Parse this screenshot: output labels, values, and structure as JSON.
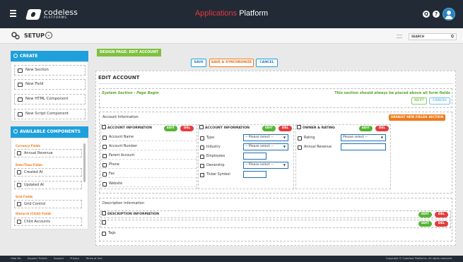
{
  "header": {
    "logo_text": "codeless",
    "logo_sub": "PLATFORMS",
    "title_accent": "Applications",
    "title_rest": " Platform",
    "icons": [
      "search-icon",
      "help-icon",
      "user-avatar"
    ],
    "search_icon_glyph": "Q",
    "help_icon_glyph": "?"
  },
  "subbar": {
    "setup_label": "SETUP",
    "chevron_glyph": "⌄",
    "search_placeholder": "SEARCH",
    "search_glyph": "Q"
  },
  "sidebar": {
    "create": {
      "title": "CREATE",
      "items": [
        {
          "label": "New Section",
          "icon": "section-icon"
        },
        {
          "label": "New Field",
          "icon": "field-icon"
        },
        {
          "label": "New HTML Component",
          "icon": "html-icon"
        },
        {
          "label": "New Script Component",
          "icon": "script-icon"
        }
      ]
    },
    "available": {
      "title": "AVAILABLE COMPONENTS",
      "groups": [
        {
          "category": "Currency Fields",
          "items": [
            "Annual Revenue"
          ]
        },
        {
          "category": "Date/Time Fields",
          "items": [
            "Created At",
            "Updated At"
          ]
        },
        {
          "category": "Grid Fields",
          "items": [
            "Grid Control"
          ]
        },
        {
          "category": "Hierarch (Child) Fields",
          "items": [
            "Child Accounts"
          ]
        }
      ]
    }
  },
  "toolbar": {
    "design_page": "DESIGN PAGE: EDIT ACCOUNT",
    "save": "SAVE",
    "save_sync": "SAVE & SYNCHRONIZE",
    "cancel": "CANCEL"
  },
  "form": {
    "title": "EDIT ACCOUNT",
    "system_section_left": "System Section - Page Begin",
    "system_section_right": "This section should always be placed above all form fields",
    "next": "NEXT",
    "cancel": "CANCEL",
    "account_info": {
      "label": "Account Information",
      "default_badge": "DEFAULT NEW FIELDS SECTION",
      "columns": [
        {
          "title": "ACCOUNT INFORMATION",
          "fields": [
            "Account Name",
            "Account Number",
            "Parent Account",
            "Phone",
            "Fax",
            "Website"
          ]
        },
        {
          "title": "ACCOUNT INFORMATION",
          "fields": [
            "Type",
            "Industry",
            "Employees",
            "Ownership",
            "Ticker Symbol"
          ],
          "select_placeholder": "-- Please select --"
        },
        {
          "title": "OWNER & RATING",
          "fields": [
            "Rating",
            "Annual Revenue"
          ],
          "select_placeholder": "Please select --"
        }
      ],
      "edit": "EDIT",
      "del": "DEL"
    },
    "description_info": {
      "label": "Description Information",
      "rows": [
        "DESCRIPTION INFORMATION",
        "",
        "Tags"
      ]
    }
  },
  "footer": {
    "links": [
      "Help Me",
      "Support Tickets",
      "Support",
      "Privacy",
      "Terms of Use"
    ],
    "copyright": "Copyright © Codeless Platforms. All rights reserved."
  },
  "colors": {
    "topbar": "#222a35",
    "accent_red": "#e6373d",
    "brand_blue": "#1ea0dc",
    "green": "#55b533",
    "orange": "#f07a1a"
  }
}
